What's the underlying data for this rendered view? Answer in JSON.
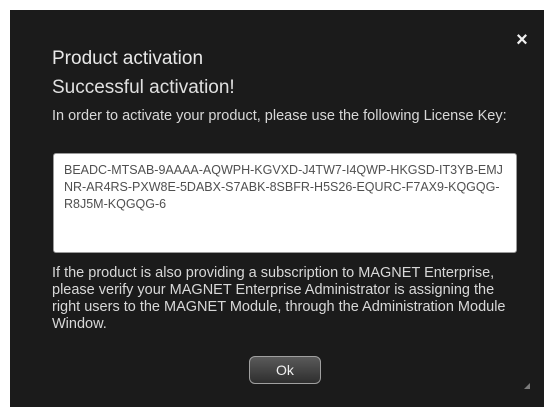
{
  "dialog": {
    "title": "Product activation",
    "close_icon": "close-icon",
    "status": "Successful activation!",
    "instructions": "In order to activate your product, please use the following License Key:",
    "license_key": "BEADC-MTSAB-9AAAA-AQWPH-KGVXD-J4TW7-I4QWP-HKGSD-IT3YB-EMJNR-AR4RS-PXW8E-5DABX-S7ABK-8SBFR-H5S26-EQURC-F7AX9-KQGQG-R8J5M-KQGQG-6",
    "note": "If the product is also providing a subscription to MAGNET Enterprise, please verify your MAGNET Enterprise Administrator is assigning the right users to the MAGNET Module, through the Administration Module Window.",
    "ok_label": "Ok"
  }
}
